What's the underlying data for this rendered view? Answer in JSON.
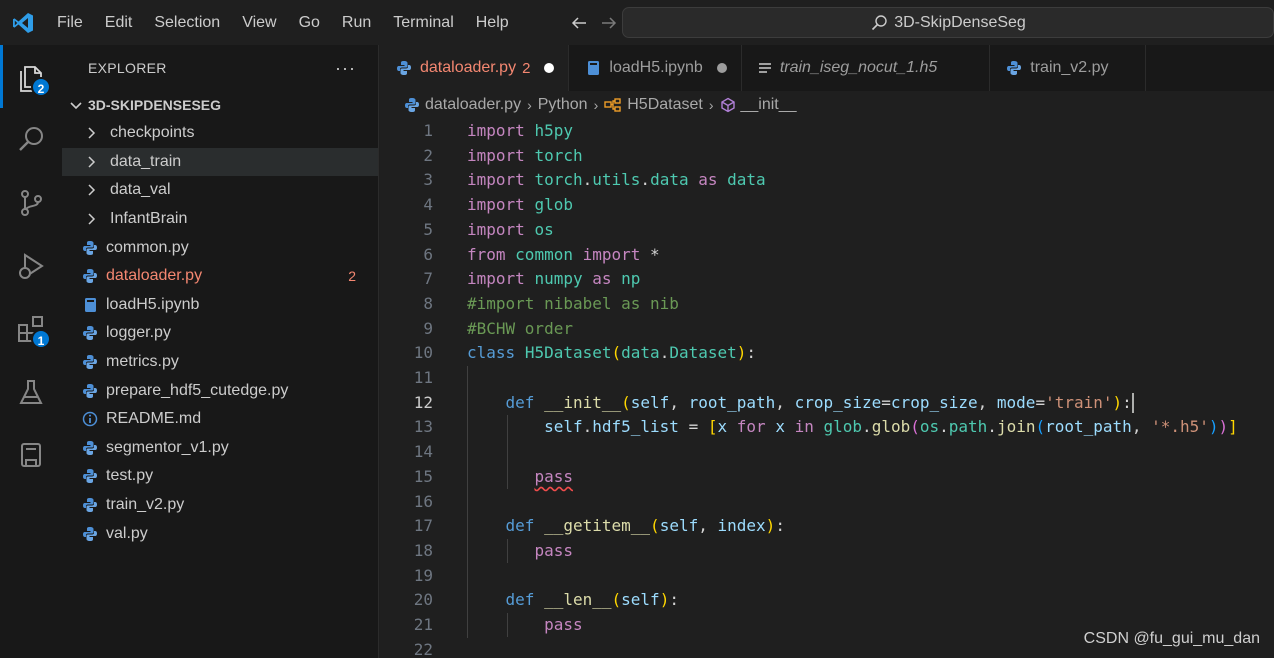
{
  "menu": [
    "File",
    "Edit",
    "Selection",
    "View",
    "Go",
    "Run",
    "Terminal",
    "Help"
  ],
  "command_center": {
    "label": "3D-SkipDenseSeg"
  },
  "activity": {
    "explorer_badge": "2",
    "extensions_badge": "1"
  },
  "sidebar": {
    "title": "EXPLORER",
    "more": "···",
    "folder": "3D-SKIPDENSESEG",
    "items": [
      {
        "label": "checkpoints",
        "type": "folder"
      },
      {
        "label": "data_train",
        "type": "folder"
      },
      {
        "label": "data_val",
        "type": "folder"
      },
      {
        "label": "InfantBrain",
        "type": "folder"
      },
      {
        "label": "common.py",
        "type": "py"
      },
      {
        "label": "dataloader.py",
        "type": "py",
        "count": "2"
      },
      {
        "label": "loadH5.ipynb",
        "type": "nb"
      },
      {
        "label": "logger.py",
        "type": "py"
      },
      {
        "label": "metrics.py",
        "type": "py"
      },
      {
        "label": "prepare_hdf5_cutedge.py",
        "type": "py"
      },
      {
        "label": "README.md",
        "type": "info"
      },
      {
        "label": "segmentor_v1.py",
        "type": "py"
      },
      {
        "label": "test.py",
        "type": "py"
      },
      {
        "label": "train_v2.py",
        "type": "py"
      },
      {
        "label": "val.py",
        "type": "py"
      }
    ]
  },
  "tabs": [
    {
      "label": "dataloader.py",
      "count": "2"
    },
    {
      "label": "loadH5.ipynb"
    },
    {
      "label": "train_iseg_nocut_1.h5"
    },
    {
      "label": "train_v2.py"
    }
  ],
  "breadcrumb": [
    "dataloader.py",
    "Python",
    "H5Dataset",
    "__init__"
  ],
  "editor": {
    "line_numbers": [
      "1",
      "2",
      "3",
      "4",
      "5",
      "6",
      "7",
      "8",
      "9",
      "10",
      "11",
      "12",
      "13",
      "14",
      "15",
      "16",
      "17",
      "18",
      "19",
      "20",
      "21",
      "22"
    ],
    "current_line": "12"
  },
  "watermark": "CSDN @fu_gui_mu_dan",
  "colors": {
    "accent": "#0078d4",
    "error": "#f48771",
    "keyword": "#c586c0",
    "string": "#ce9178",
    "comment": "#6a9955"
  }
}
